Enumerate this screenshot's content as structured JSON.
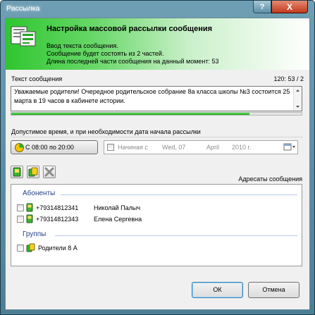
{
  "window": {
    "title": "Рассылка",
    "help_label": "?",
    "close_label": "X"
  },
  "header": {
    "title": "Настройка массовой рассылки сообщения",
    "line1": "Ввод текста сообщения.",
    "line2": "Сообщение будет состоять из 2 частей.",
    "line3": "Длина последней части сообщения на данный момент: 53"
  },
  "message": {
    "label": "Текст сообщения",
    "counter": "120: 53 / 2",
    "text": "Уважаемые родители! Очередное родительское собрание 8а класса школы №3 состоится 25 марта в 19 часов в кабинете истории.",
    "progress": 0.82
  },
  "schedule": {
    "label": "Допустимое время, и при необходимости дата начала рассылки",
    "time_button": "С 08:00 по 20:00",
    "start_label": "Начиная с",
    "weekday": "Wed, 07",
    "month": "April",
    "year": "2010 г."
  },
  "recipients": {
    "label": "Адресаты сообщения",
    "subscribers_heading": "Абоненты",
    "subscribers": [
      {
        "phone": "+79314812341",
        "name": "Николай Палыч"
      },
      {
        "phone": "+79314812343",
        "name": "Елена Сергевна"
      }
    ],
    "groups_heading": "Группы",
    "groups": [
      {
        "name": "Родители 8 А"
      }
    ]
  },
  "buttons": {
    "ok": "ОК",
    "cancel": "Отмена"
  },
  "colors": {
    "accent_green": "#2fc62f",
    "group_heading": "#1e3f84",
    "close_red": "#c23a1e"
  }
}
